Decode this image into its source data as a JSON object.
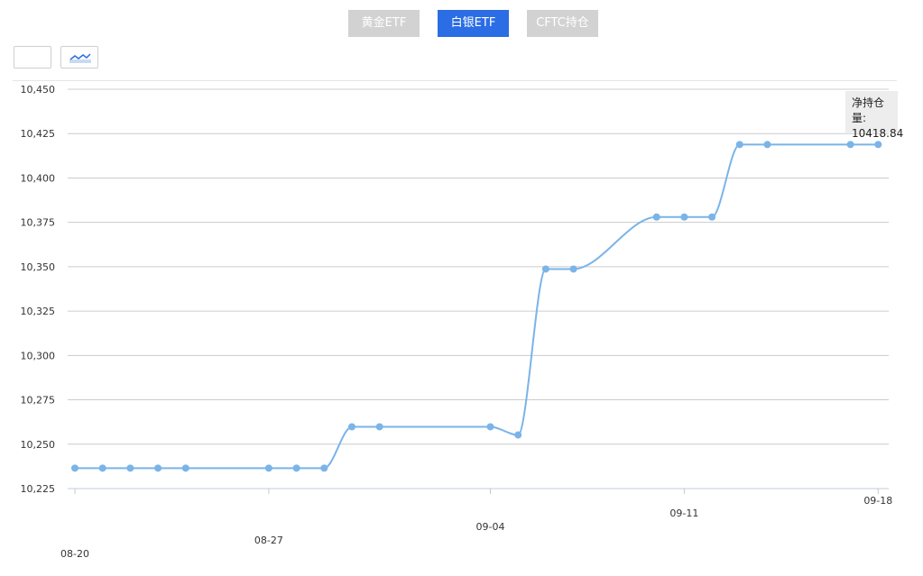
{
  "tabs": [
    {
      "label": "黄金ETF",
      "active": false
    },
    {
      "label": "白银ETF",
      "active": true
    },
    {
      "label": "CFTC持仓",
      "active": false
    }
  ],
  "chart_type_buttons": [
    {
      "icon": ""
    },
    {
      "icon": "line-chart-icon"
    }
  ],
  "tooltip": {
    "label": "净持仓量:",
    "value": "10418.84"
  },
  "colors": {
    "line": "#7ab4e8",
    "grid": "#cccccc",
    "tab_active": "#2b6de4",
    "tab_inactive": "#d2d2d2"
  },
  "chart_data": {
    "type": "line",
    "y_ticks": [
      "10,225",
      "10,250",
      "10,275",
      "10,300",
      "10,325",
      "10,350",
      "10,375",
      "10,400",
      "10,425",
      "10,450"
    ],
    "ylim": [
      10225,
      10450
    ],
    "x_ticks": [
      "08-20",
      "08-27",
      "09-04",
      "09-11",
      "09-18"
    ],
    "x_tick_days": [
      0,
      7,
      15,
      22,
      29
    ],
    "grid": true,
    "series": [
      {
        "x_days": [
          0,
          1,
          2,
          3,
          4,
          7,
          8,
          9,
          10,
          11,
          15,
          16,
          17,
          18,
          21,
          22,
          23,
          24,
          25,
          28,
          29
        ],
        "values": [
          10236.5,
          10236.5,
          10236.5,
          10236.5,
          10236.5,
          10236.5,
          10236.5,
          10236.5,
          10259.8,
          10259.8,
          10259.8,
          10255.2,
          10348.7,
          10348.7,
          10378.0,
          10378.0,
          10378.0,
          10418.84,
          10418.84,
          10418.84,
          10418.84
        ]
      }
    ]
  }
}
